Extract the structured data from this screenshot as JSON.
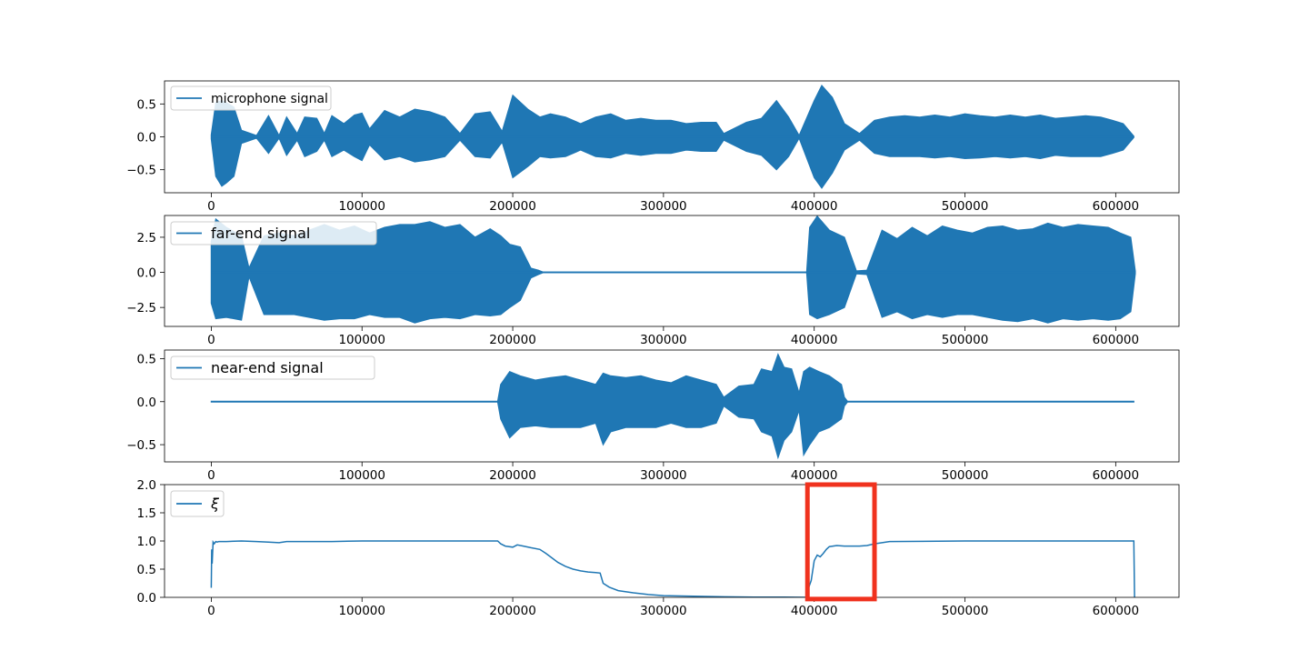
{
  "colors": {
    "line": "#1f77b4",
    "axis": "#000000",
    "legend_border": "#cccccc",
    "highlight": "#f0321e",
    "background": "#ffffff"
  },
  "chart_data": [
    {
      "type": "line",
      "legend_placement": "top-left",
      "grid": false,
      "xlim": [
        -31000,
        642000
      ],
      "ylim": [
        -0.85,
        0.85
      ],
      "x_ticks": [
        0,
        100000,
        200000,
        300000,
        400000,
        500000,
        600000
      ],
      "x_tick_labels": [
        "0",
        "100000",
        "200000",
        "300000",
        "400000",
        "500000",
        "600000"
      ],
      "y_ticks": [
        -0.5,
        0.0,
        0.5
      ],
      "y_tick_labels": [
        "−0.5",
        "0.0",
        "0.5"
      ],
      "series": [
        {
          "name": "microphone signal",
          "style": "envelope",
          "x": [
            0,
            3000,
            7000,
            10000,
            15000,
            20000,
            30000,
            38000,
            45000,
            50000,
            57000,
            62000,
            70000,
            75000,
            80000,
            88000,
            95000,
            100000,
            105000,
            115000,
            125000,
            135000,
            145000,
            155000,
            165000,
            175000,
            185000,
            193000,
            200000,
            210000,
            218000,
            225000,
            235000,
            245000,
            255000,
            265000,
            275000,
            285000,
            295000,
            305000,
            315000,
            325000,
            335000,
            340000,
            355000,
            365000,
            375000,
            383000,
            390000,
            400000,
            405000,
            412000,
            420000,
            430000,
            440000,
            450000,
            460000,
            470000,
            480000,
            490000,
            500000,
            510000,
            520000,
            530000,
            540000,
            550000,
            560000,
            570000,
            580000,
            590000,
            598000,
            605000,
            612000
          ],
          "upper": [
            0.03,
            0.52,
            0.55,
            0.52,
            0.45,
            0.1,
            0.02,
            0.32,
            0.02,
            0.3,
            0.05,
            0.3,
            0.28,
            0.05,
            0.32,
            0.2,
            0.33,
            0.36,
            0.12,
            0.4,
            0.3,
            0.42,
            0.38,
            0.3,
            0.05,
            0.35,
            0.38,
            0.08,
            0.63,
            0.42,
            0.3,
            0.35,
            0.3,
            0.2,
            0.3,
            0.35,
            0.25,
            0.28,
            0.25,
            0.25,
            0.2,
            0.22,
            0.22,
            0.05,
            0.22,
            0.28,
            0.55,
            0.3,
            0.02,
            0.55,
            0.78,
            0.6,
            0.2,
            0.05,
            0.25,
            0.3,
            0.32,
            0.3,
            0.33,
            0.3,
            0.35,
            0.32,
            0.3,
            0.33,
            0.3,
            0.33,
            0.28,
            0.3,
            0.32,
            0.3,
            0.25,
            0.2,
            0.01
          ],
          "lower": [
            -0.03,
            -0.6,
            -0.75,
            -0.7,
            -0.6,
            -0.1,
            -0.02,
            -0.25,
            -0.02,
            -0.28,
            -0.05,
            -0.3,
            -0.22,
            -0.05,
            -0.3,
            -0.2,
            -0.3,
            -0.36,
            -0.12,
            -0.35,
            -0.3,
            -0.38,
            -0.35,
            -0.3,
            -0.05,
            -0.3,
            -0.32,
            -0.08,
            -0.62,
            -0.45,
            -0.3,
            -0.32,
            -0.3,
            -0.2,
            -0.3,
            -0.32,
            -0.25,
            -0.28,
            -0.25,
            -0.25,
            -0.2,
            -0.22,
            -0.22,
            -0.05,
            -0.22,
            -0.28,
            -0.5,
            -0.3,
            -0.02,
            -0.62,
            -0.78,
            -0.55,
            -0.2,
            -0.05,
            -0.25,
            -0.3,
            -0.3,
            -0.3,
            -0.32,
            -0.3,
            -0.33,
            -0.32,
            -0.3,
            -0.32,
            -0.3,
            -0.33,
            -0.28,
            -0.3,
            -0.3,
            -0.3,
            -0.25,
            -0.2,
            -0.01
          ]
        }
      ]
    },
    {
      "type": "line",
      "legend_placement": "top-left",
      "grid": false,
      "xlim": [
        -31000,
        642000
      ],
      "ylim": [
        -3.85,
        4.05
      ],
      "x_ticks": [
        0,
        100000,
        200000,
        300000,
        400000,
        500000,
        600000
      ],
      "x_tick_labels": [
        "0",
        "100000",
        "200000",
        "300000",
        "400000",
        "500000",
        "600000"
      ],
      "y_ticks": [
        -2.5,
        0.0,
        2.5
      ],
      "y_tick_labels": [
        "−2.5",
        "0.0",
        "2.5"
      ],
      "series": [
        {
          "name": "far-end signal",
          "style": "envelope",
          "x": [
            0,
            3000,
            10000,
            20000,
            25000,
            35000,
            45000,
            55000,
            65000,
            75000,
            85000,
            95000,
            105000,
            115000,
            125000,
            135000,
            145000,
            155000,
            165000,
            175000,
            185000,
            192000,
            198000,
            205000,
            212000,
            217000,
            220000,
            395000,
            397000,
            402000,
            410000,
            420000,
            428000,
            435000,
            445000,
            455000,
            465000,
            475000,
            485000,
            495000,
            505000,
            515000,
            525000,
            535000,
            545000,
            555000,
            565000,
            575000,
            585000,
            595000,
            603000,
            610000,
            613000
          ],
          "upper": [
            2.2,
            3.8,
            3.2,
            2.6,
            0.3,
            2.6,
            2.8,
            2.6,
            3.0,
            3.4,
            3.0,
            3.3,
            2.8,
            3.2,
            3.4,
            3.4,
            3.6,
            3.2,
            3.4,
            2.5,
            3.1,
            2.6,
            2.0,
            1.8,
            0.3,
            0.15,
            0.02,
            0.02,
            3.2,
            4.0,
            3.0,
            2.5,
            0.1,
            0.15,
            3.0,
            2.4,
            3.2,
            2.6,
            3.3,
            3.0,
            2.8,
            3.2,
            3.3,
            3.0,
            3.1,
            3.5,
            3.2,
            3.4,
            3.3,
            3.2,
            2.8,
            2.5,
            0.1
          ],
          "lower": [
            -2.2,
            -3.3,
            -3.2,
            -3.4,
            -0.3,
            -3.0,
            -3.0,
            -3.0,
            -3.2,
            -3.4,
            -3.3,
            -3.3,
            -3.0,
            -3.2,
            -3.2,
            -3.6,
            -3.3,
            -3.2,
            -3.3,
            -3.0,
            -3.1,
            -3.0,
            -2.5,
            -2.0,
            -0.4,
            -0.15,
            -0.02,
            -0.02,
            -3.0,
            -3.3,
            -3.0,
            -2.5,
            -0.1,
            -0.15,
            -3.2,
            -2.8,
            -3.3,
            -3.0,
            -3.2,
            -3.0,
            -3.0,
            -3.2,
            -3.4,
            -3.5,
            -3.3,
            -3.6,
            -3.3,
            -3.4,
            -3.3,
            -3.4,
            -3.3,
            -2.8,
            -0.1
          ]
        }
      ]
    },
    {
      "type": "line",
      "legend_placement": "top-left",
      "grid": false,
      "xlim": [
        -31000,
        642000
      ],
      "ylim": [
        -0.7,
        0.6
      ],
      "x_ticks": [
        0,
        100000,
        200000,
        300000,
        400000,
        500000,
        600000
      ],
      "x_tick_labels": [
        "0",
        "100000",
        "200000",
        "300000",
        "400000",
        "500000",
        "600000"
      ],
      "y_ticks": [
        -0.5,
        0.0,
        0.5
      ],
      "y_tick_labels": [
        "−0.5",
        "0.0",
        "0.5"
      ],
      "series": [
        {
          "name": "near-end signal",
          "style": "envelope",
          "x": [
            0,
            190000,
            192000,
            198000,
            205000,
            215000,
            225000,
            235000,
            245000,
            255000,
            260000,
            265000,
            275000,
            285000,
            295000,
            305000,
            315000,
            325000,
            335000,
            340000,
            350000,
            360000,
            365000,
            372000,
            376000,
            380000,
            385000,
            390000,
            393000,
            397000,
            403000,
            410000,
            418000,
            420000,
            422000,
            612000
          ],
          "upper": [
            0.005,
            0.005,
            0.2,
            0.35,
            0.3,
            0.25,
            0.28,
            0.3,
            0.25,
            0.2,
            0.33,
            0.3,
            0.28,
            0.3,
            0.25,
            0.22,
            0.3,
            0.25,
            0.2,
            0.05,
            0.18,
            0.2,
            0.38,
            0.35,
            0.55,
            0.4,
            0.38,
            0.1,
            0.35,
            0.4,
            0.35,
            0.3,
            0.2,
            0.05,
            0.005,
            0.005
          ],
          "lower": [
            -0.005,
            -0.005,
            -0.2,
            -0.42,
            -0.3,
            -0.28,
            -0.3,
            -0.3,
            -0.3,
            -0.25,
            -0.5,
            -0.35,
            -0.3,
            -0.3,
            -0.3,
            -0.25,
            -0.3,
            -0.3,
            -0.25,
            -0.05,
            -0.18,
            -0.2,
            -0.35,
            -0.4,
            -0.65,
            -0.45,
            -0.35,
            -0.1,
            -0.62,
            -0.5,
            -0.35,
            -0.3,
            -0.2,
            -0.05,
            -0.005,
            -0.005
          ]
        }
      ]
    },
    {
      "type": "line",
      "legend_placement": "top-left",
      "grid": false,
      "xlim": [
        -31000,
        642000
      ],
      "ylim": [
        0,
        2.0
      ],
      "x_ticks": [
        0,
        100000,
        200000,
        300000,
        400000,
        500000,
        600000
      ],
      "x_tick_labels": [
        "0",
        "100000",
        "200000",
        "300000",
        "400000",
        "500000",
        "600000"
      ],
      "y_ticks": [
        0.0,
        0.5,
        1.0,
        1.5,
        2.0
      ],
      "y_tick_labels": [
        "0.0",
        "0.5",
        "1.0",
        "1.5",
        "2.0"
      ],
      "series": [
        {
          "name": "ξ",
          "style": "line",
          "x": [
            0,
            300,
            600,
            1200,
            2000,
            3000,
            4000,
            5000,
            10000,
            20000,
            30000,
            38000,
            45000,
            50000,
            80000,
            100000,
            150000,
            190000,
            192000,
            195000,
            200000,
            203000,
            207000,
            212000,
            218000,
            222000,
            226000,
            230000,
            235000,
            240000,
            245000,
            250000,
            255000,
            258000,
            260000,
            264000,
            270000,
            280000,
            290000,
            300000,
            320000,
            340000,
            360000,
            380000,
            395000,
            396000,
            398000,
            400000,
            402000,
            404000,
            406000,
            408000,
            410000,
            415000,
            420000,
            425000,
            430000,
            435000,
            440000,
            445000,
            450000,
            500000,
            550000,
            600000,
            612000,
            612500
          ],
          "y": [
            0.17,
            0.85,
            0.6,
            0.98,
            0.95,
            0.99,
            0.98,
            0.99,
            0.99,
            1.0,
            0.99,
            0.98,
            0.97,
            0.99,
            0.99,
            1.0,
            1.0,
            1.0,
            0.95,
            0.91,
            0.89,
            0.93,
            0.91,
            0.88,
            0.85,
            0.78,
            0.7,
            0.62,
            0.55,
            0.5,
            0.47,
            0.45,
            0.44,
            0.43,
            0.25,
            0.18,
            0.12,
            0.08,
            0.05,
            0.03,
            0.02,
            0.01,
            0.005,
            0.003,
            0.0,
            0.15,
            0.3,
            0.65,
            0.75,
            0.72,
            0.78,
            0.85,
            0.9,
            0.92,
            0.91,
            0.91,
            0.91,
            0.92,
            0.95,
            0.97,
            0.99,
            1.0,
            1.0,
            1.0,
            1.0,
            0.0
          ]
        }
      ],
      "highlight_box": {
        "x": [
          395500,
          440000
        ],
        "y": [
          -0.03,
          2.0
        ]
      }
    }
  ]
}
